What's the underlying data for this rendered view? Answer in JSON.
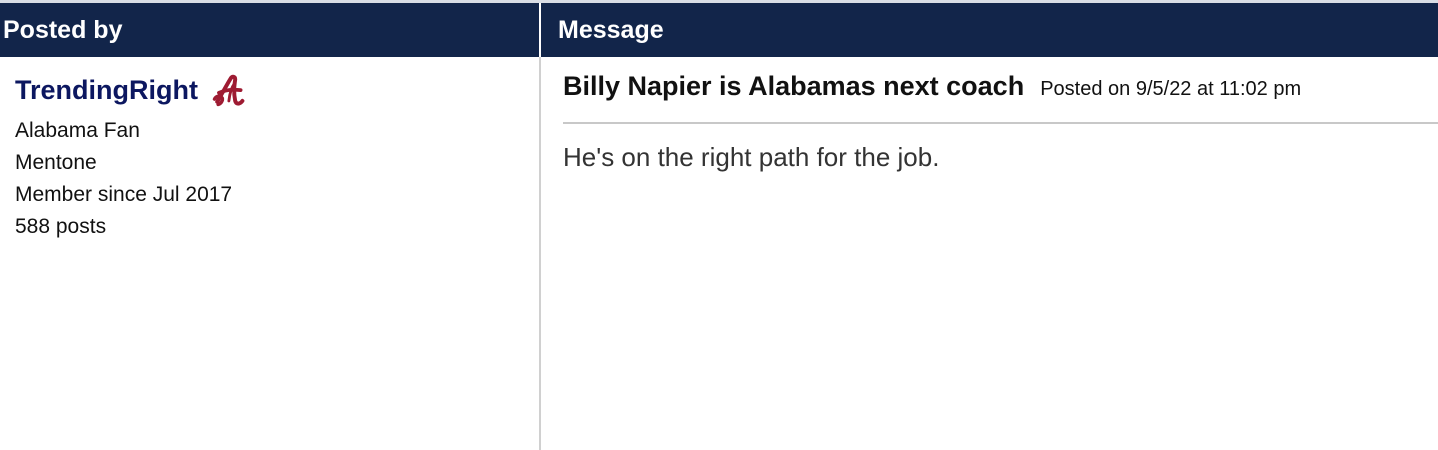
{
  "table": {
    "header": {
      "posted_by_label": "Posted by",
      "message_label": "Message"
    },
    "colors": {
      "header_background": "#12254a",
      "header_text": "#ffffff",
      "username_color": "#0c1760",
      "logo_color": "#9e1b32"
    }
  },
  "user": {
    "username": "TrendingRight",
    "team_logo_icon": "alabama-script-a-icon",
    "fan_label": "Alabama Fan",
    "location": "Mentone",
    "member_since": "Member since Jul 2017",
    "post_count": "588 posts"
  },
  "post": {
    "title": "Billy Napier is Alabamas next coach",
    "posted_on": "Posted on 9/5/22 at 11:02 pm",
    "body": "He's on the right path for the job."
  }
}
